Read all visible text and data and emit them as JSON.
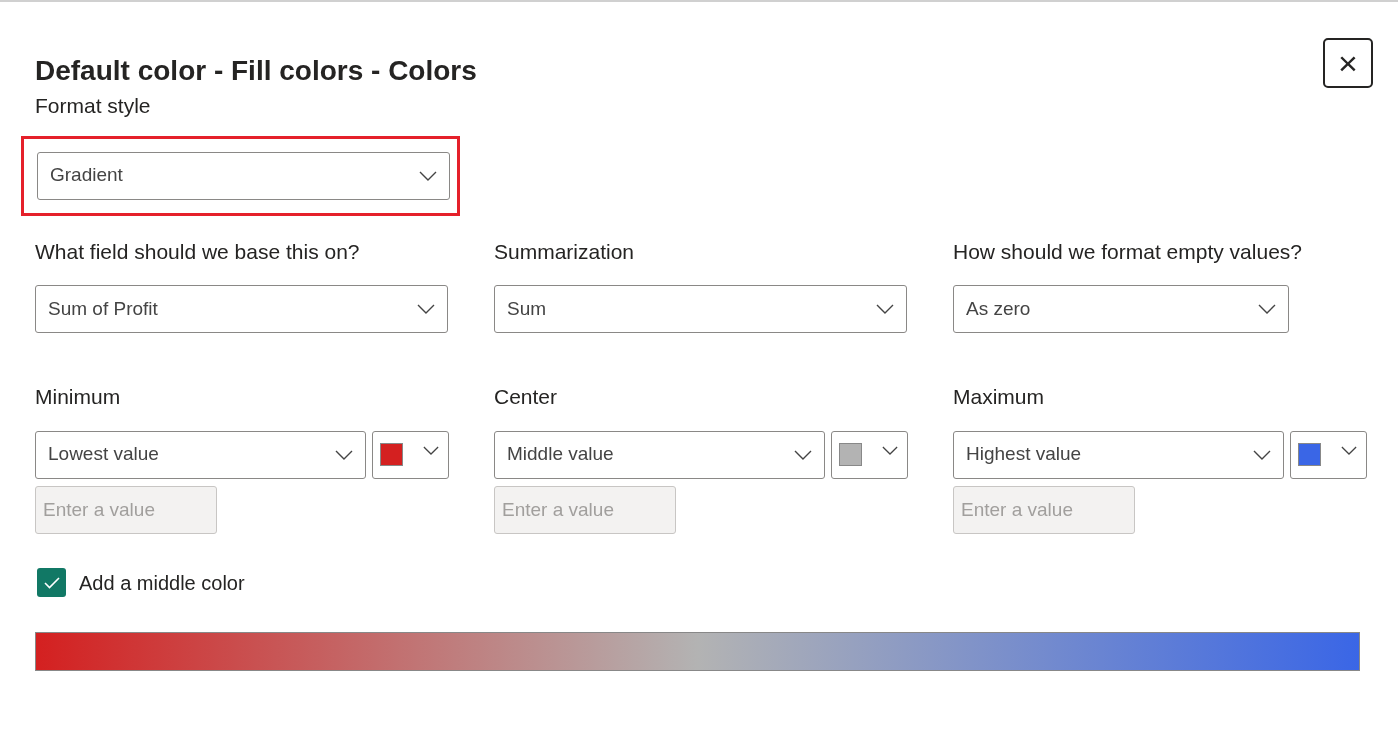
{
  "dialog": {
    "title": "Default color - Fill colors - Colors",
    "close": "×"
  },
  "format_style": {
    "label": "Format style",
    "value": "Gradient",
    "highlighted": true
  },
  "fields": [
    {
      "label": "What field should we base this on?",
      "value": "Sum of Profit"
    },
    {
      "label": "Summarization",
      "value": "Sum"
    },
    {
      "label": "How should we format empty values?",
      "value": "As zero"
    }
  ],
  "stops": [
    {
      "label": "Minimum",
      "value": "Lowest value",
      "color": "#d42020",
      "placeholder": "Enter a value"
    },
    {
      "label": "Center",
      "value": "Middle value",
      "color": "#b3b3b3",
      "placeholder": "Enter a value"
    },
    {
      "label": "Maximum",
      "value": "Highest value",
      "color": "#3a66e6",
      "placeholder": "Enter a value"
    }
  ],
  "middle_color": {
    "label": "Add a middle color",
    "checked": true
  }
}
